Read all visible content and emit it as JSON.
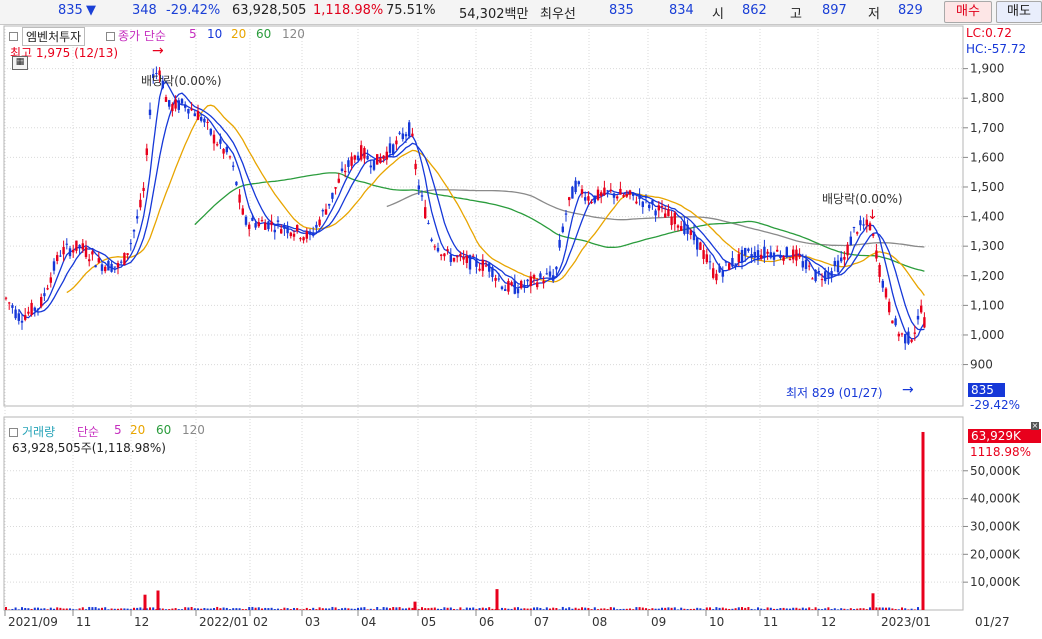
{
  "quote": {
    "price": "835",
    "change": "348",
    "change_pct": "-29.42%",
    "volume": "63,928,505",
    "volume_ratio": "1,118.98%",
    "turnover": "75.51%",
    "amount": "54,302백만",
    "best_label": "최우선",
    "best_ask": "835",
    "best_bid": "834",
    "open_label": "시",
    "open": "862",
    "high_label": "고",
    "high": "897",
    "low_label": "저",
    "low": "829",
    "buy_button": "매수",
    "sell_button": "매도"
  },
  "price_panel": {
    "stock_name": "엠벤처투자",
    "indicator_label": "종가 단순",
    "ma": [
      "5",
      "10",
      "20",
      "60",
      "120"
    ],
    "lc": "LC:0.72",
    "hc": "HC:-57.72",
    "max_note": "최고 1,975 (12/13)",
    "min_note": "최저 829 (01/27)",
    "dividend_1": "배당락(0.00%)",
    "dividend_2": "배당락(0.00%)",
    "current_price_box": "835",
    "current_change": "-29.42%"
  },
  "volume_panel": {
    "title": "거래량",
    "indicator_label": "단순",
    "ma": [
      "5",
      "20",
      "60",
      "120"
    ],
    "info": "63,928,505주(1,118.98%)",
    "current_box": "63,929K",
    "current_ratio": "1118.98%"
  },
  "colors": {
    "up": "#e8001c",
    "down": "#1638d8",
    "ma5": "#1638d8",
    "ma10": "#1638d8",
    "ma20": "#e8a500",
    "ma60": "#2a9c3c",
    "ma120": "#8a8a8a"
  },
  "chart_data": {
    "type": "candlestick",
    "price_axis": {
      "ticks": [
        "1,900",
        "1,800",
        "1,700",
        "1,600",
        "1,500",
        "1,400",
        "1,300",
        "1,200",
        "1,100",
        "1,000",
        "900"
      ],
      "range": [
        760,
        2000
      ]
    },
    "volume_axis": {
      "ticks": [
        "50,000K",
        "40,000K",
        "30,000K",
        "20,000K",
        "10,000K"
      ],
      "range": [
        0,
        65000
      ]
    },
    "x_ticks": [
      "2021/09",
      "11",
      "12",
      "2022/01",
      "02",
      "03",
      "04",
      "05",
      "06",
      "07",
      "08",
      "09",
      "10",
      "11",
      "12",
      "2023/01"
    ],
    "last_date_label": "01/27",
    "price_anchors": [
      [
        0,
        1150
      ],
      [
        20,
        1060
      ],
      [
        40,
        1100
      ],
      [
        60,
        1280
      ],
      [
        80,
        1300
      ],
      [
        100,
        1240
      ],
      [
        120,
        1230
      ],
      [
        130,
        1300
      ],
      [
        145,
        1500
      ],
      [
        152,
        1870
      ],
      [
        160,
        1900
      ],
      [
        168,
        1770
      ],
      [
        185,
        1780
      ],
      [
        200,
        1740
      ],
      [
        215,
        1660
      ],
      [
        230,
        1600
      ],
      [
        245,
        1380
      ],
      [
        265,
        1380
      ],
      [
        290,
        1360
      ],
      [
        310,
        1330
      ],
      [
        325,
        1420
      ],
      [
        345,
        1560
      ],
      [
        360,
        1620
      ],
      [
        375,
        1580
      ],
      [
        395,
        1640
      ],
      [
        410,
        1700
      ],
      [
        420,
        1480
      ],
      [
        432,
        1330
      ],
      [
        445,
        1270
      ],
      [
        465,
        1250
      ],
      [
        490,
        1230
      ],
      [
        505,
        1160
      ],
      [
        520,
        1160
      ],
      [
        540,
        1190
      ],
      [
        555,
        1200
      ],
      [
        565,
        1400
      ],
      [
        575,
        1510
      ],
      [
        590,
        1460
      ],
      [
        610,
        1480
      ],
      [
        640,
        1460
      ],
      [
        660,
        1420
      ],
      [
        680,
        1380
      ],
      [
        700,
        1300
      ],
      [
        715,
        1200
      ],
      [
        730,
        1240
      ],
      [
        745,
        1270
      ],
      [
        770,
        1280
      ],
      [
        795,
        1270
      ],
      [
        815,
        1200
      ],
      [
        830,
        1210
      ],
      [
        845,
        1260
      ],
      [
        855,
        1360
      ],
      [
        870,
        1370
      ],
      [
        880,
        1220
      ],
      [
        890,
        1080
      ],
      [
        900,
        1000
      ],
      [
        910,
        985
      ],
      [
        918,
        1040
      ],
      [
        922,
        1120
      ],
      [
        925,
        1010
      ],
      [
        927,
        835
      ]
    ],
    "volume_spikes": [
      [
        145,
        5500
      ],
      [
        158,
        7000
      ],
      [
        415,
        3000
      ],
      [
        497,
        7500
      ],
      [
        873,
        6000
      ],
      [
        923,
        63929
      ]
    ]
  }
}
